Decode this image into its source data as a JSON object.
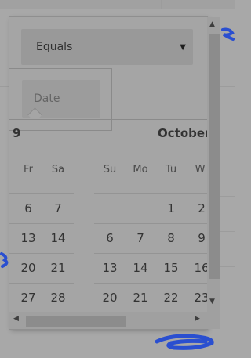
{
  "filter": {
    "operator_value": "Equals",
    "date_placeholder": "Date"
  },
  "calendar": {
    "left_month_label": "9",
    "right_month_label": "October",
    "left_weekdays": [
      "Fr",
      "Sa"
    ],
    "right_weekdays": [
      "Su",
      "Mo",
      "Tu",
      "W"
    ],
    "left_rows": [
      [
        "6",
        "7"
      ],
      [
        "13",
        "14"
      ],
      [
        "20",
        "21"
      ],
      [
        "27",
        "28"
      ]
    ],
    "right_rows": [
      [
        "",
        "",
        "1",
        "2"
      ],
      [
        "6",
        "7",
        "8",
        "9"
      ],
      [
        "13",
        "14",
        "15",
        "16"
      ],
      [
        "20",
        "21",
        "22",
        "23"
      ]
    ]
  },
  "icons": {
    "dropdown": "triangle-down",
    "scroll_up": "triangle-up",
    "scroll_down": "triangle-down",
    "scroll_left": "triangle-left",
    "scroll_right": "triangle-right"
  },
  "colors": {
    "overlay": "#a8a8a8",
    "scribble": "#2a4fd0"
  }
}
